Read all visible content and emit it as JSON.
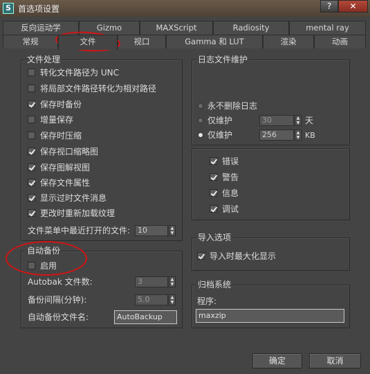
{
  "window": {
    "title": "首选项设置",
    "help": "?",
    "close": "✕"
  },
  "tabs_row1": [
    {
      "label": "反向运动学"
    },
    {
      "label": "Gizmo"
    },
    {
      "label": "MAXScript"
    },
    {
      "label": "Radiosity"
    },
    {
      "label": "mental ray"
    }
  ],
  "tabs_row2": [
    {
      "label": "常规"
    },
    {
      "label": "文件"
    },
    {
      "label": "视口"
    },
    {
      "label": "Gamma 和 LUT"
    },
    {
      "label": "渲染"
    },
    {
      "label": "动画"
    }
  ],
  "active_tab": "文件",
  "file_handling": {
    "title": "文件处理",
    "options": [
      {
        "label": "转化文件路径为 UNC",
        "checked": false
      },
      {
        "label": "将局部文件路径转化为相对路径",
        "checked": false
      },
      {
        "label": "保存时备份",
        "checked": true
      },
      {
        "label": "增量保存",
        "checked": false
      },
      {
        "label": "保存时压缩",
        "checked": false
      },
      {
        "label": "保存视口缩略图",
        "checked": true
      },
      {
        "label": "保存图解视图",
        "checked": true
      },
      {
        "label": "保存文件属性",
        "checked": true
      },
      {
        "label": "显示过时文件消息",
        "checked": true
      },
      {
        "label": "更改时重新加载纹理",
        "checked": true
      }
    ],
    "recent_files_label": "文件菜单中最近打开的文件:",
    "recent_files_value": "10"
  },
  "auto_backup": {
    "title": "自动备份",
    "enable_label": "启用",
    "enabled": false,
    "count_label": "Autobak 文件数:",
    "count_value": "3",
    "interval_label": "备份间隔(分钟):",
    "interval_value": "5.0",
    "filename_label": "自动备份文件名:",
    "filename_value": "AutoBackup"
  },
  "log": {
    "title": "日志文件维护",
    "never_delete": "永不删除日志",
    "keep_days_label": "仅维护",
    "keep_days_value": "30",
    "days_unit": "天",
    "keep_kb_label": "仅维护",
    "keep_kb_value": "256",
    "kb_unit": "KB",
    "selected": "kb",
    "types": [
      {
        "label": "错误",
        "checked": true
      },
      {
        "label": "警告",
        "checked": true
      },
      {
        "label": "信息",
        "checked": true
      },
      {
        "label": "调试",
        "checked": true
      }
    ]
  },
  "import": {
    "title": "导入选项",
    "maximize_label": "导入时最大化显示",
    "maximize": true
  },
  "archive": {
    "title": "归档系统",
    "program_label": "程序:",
    "program_value": "maxzip"
  },
  "footer": {
    "ok": "确定",
    "cancel": "取消"
  },
  "colors": {
    "background": "#444444",
    "annotation": "#d21414"
  }
}
